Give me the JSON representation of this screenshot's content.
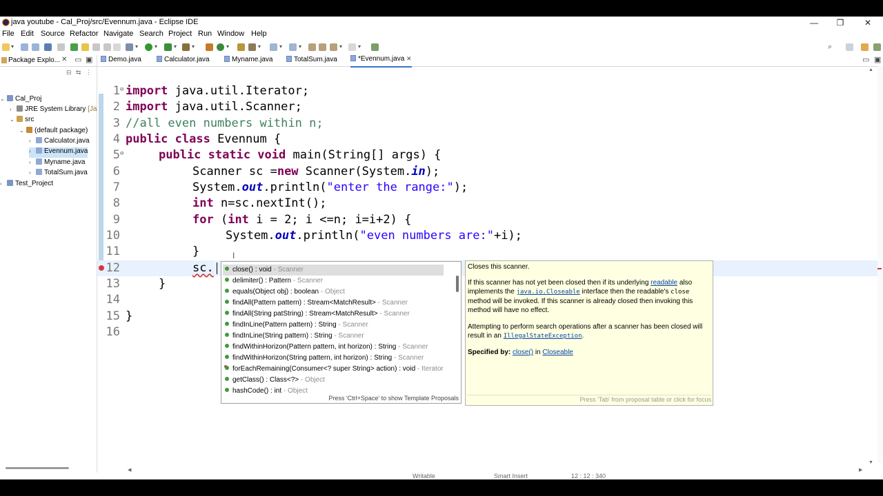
{
  "window": {
    "title": "java youtube - Cal_Proj/src/Evennum.java - Eclipse IDE",
    "minimize": "—",
    "restore": "❐",
    "close": "✕"
  },
  "menu": [
    "File",
    "Edit",
    "Source",
    "Refactor",
    "Navigate",
    "Search",
    "Project",
    "Run",
    "Window",
    "Help"
  ],
  "package_explorer": {
    "tab_label": "Package Explo...",
    "tree": [
      {
        "label": "Cal_Proj",
        "icon": "project-icon"
      },
      {
        "label": "JRE System Library",
        "suffix": "[Ja",
        "icon": "library-icon"
      },
      {
        "label": "src",
        "icon": "source-folder-icon"
      },
      {
        "label": "(default package)",
        "icon": "package-icon"
      },
      {
        "label": "Calculator.java",
        "icon": "java-file-icon"
      },
      {
        "label": "Evennum.java",
        "icon": "java-file-icon"
      },
      {
        "label": "Myname.java",
        "icon": "java-file-icon"
      },
      {
        "label": "TotalSum.java",
        "icon": "java-file-icon"
      },
      {
        "label": "Test_Project",
        "icon": "project-icon"
      }
    ]
  },
  "editor_tabs": [
    "Demo.java",
    "Calculator.java",
    "Myname.java",
    "TotalSum.java",
    "*Evennum.java"
  ],
  "code_lines": [
    {
      "n": "1",
      "marker": "⊖"
    },
    {
      "n": "2"
    },
    {
      "n": "3"
    },
    {
      "n": "4"
    },
    {
      "n": "5",
      "marker": "⊖"
    },
    {
      "n": "6"
    },
    {
      "n": "7"
    },
    {
      "n": "8"
    },
    {
      "n": "9"
    },
    {
      "n": "10"
    },
    {
      "n": "11"
    },
    {
      "n": "12"
    },
    {
      "n": "13"
    },
    {
      "n": "14"
    },
    {
      "n": "15"
    },
    {
      "n": "16"
    }
  ],
  "code": {
    "l1_kw": "import",
    "l1_rest": " java.util.Iterator;",
    "l2_kw": "import",
    "l2_rest": " java.util.Scanner;",
    "l3": "//all even numbers within n;",
    "l4_kw": "public class",
    "l4_rest": " Evennum {",
    "l5_kw": "public static void",
    "l5_rest": " main(String[] args) {",
    "l6_a": "Scanner sc =",
    "l6_kw": "new",
    "l6_b": " Scanner(System.",
    "l6_fl": "in",
    "l6_c": ");",
    "l7_a": "System.",
    "l7_fl": "out",
    "l7_b": ".println(",
    "l7_st": "\"enter the range:\"",
    "l7_c": ");",
    "l8_kw": "int",
    "l8_rest": " n=sc.nextInt();",
    "l9_kw": "for",
    "l9_a": " (",
    "l9_kw2": "int",
    "l9_b": " i = 2; i <=n; i=i+2) {",
    "l10_a": "System.",
    "l10_fl": "out",
    "l10_b": ".println(",
    "l10_st": "\"even numbers are:\"",
    "l10_c": "+i);",
    "l11": "}",
    "l12": "sc.",
    "l13": "}",
    "l15": "}"
  },
  "completion": {
    "proposals": [
      {
        "sig": "close() : void",
        "qual": "Scanner"
      },
      {
        "sig": "delimiter() : Pattern",
        "qual": "Scanner"
      },
      {
        "sig": "equals(Object obj) : boolean",
        "qual": "Object"
      },
      {
        "sig": "findAll(Pattern pattern) : Stream<MatchResult>",
        "qual": "Scanner"
      },
      {
        "sig": "findAll(String patString) : Stream<MatchResult>",
        "qual": "Scanner"
      },
      {
        "sig": "findInLine(Pattern pattern) : String",
        "qual": "Scanner"
      },
      {
        "sig": "findInLine(String pattern) : String",
        "qual": "Scanner"
      },
      {
        "sig": "findWithinHorizon(Pattern pattern, int horizon) : String",
        "qual": "Scanner"
      },
      {
        "sig": "findWithinHorizon(String pattern, int horizon) : String",
        "qual": "Scanner"
      },
      {
        "sig": "forEachRemaining(Consumer<? super String> action) : void",
        "qual": "Iterator"
      },
      {
        "sig": "getClass() : Class<?>",
        "qual": "Object"
      },
      {
        "sig": "hashCode() : int",
        "qual": "Object"
      }
    ],
    "separator": " - ",
    "footer": "Press 'Ctrl+Space' to show Template Proposals"
  },
  "doc": {
    "title": "Closes this scanner.",
    "p1_a": "If this scanner has not yet been closed then if its underlying ",
    "p1_link": "readable",
    "p1_b": " also implements the ",
    "p1_code": "java.io.Closeable",
    "p1_c": " interface then the readable's ",
    "p1_code2": "close",
    "p1_d": " method will be invoked. If this scanner is already closed then invoking this method will have no effect.",
    "p2_a": "Attempting to perform search operations after a scanner has been closed will result in an ",
    "p2_code": "IllegalStateException",
    "p2_b": ".",
    "spec_label": "Specified by:",
    "spec_link1": "close()",
    "spec_in": " in ",
    "spec_link2": "Closeable",
    "footer": "Press 'Tab' from proposal table or click for focus"
  },
  "status": {
    "writable": "Writable",
    "insert": "Smart Insert",
    "position": "12 : 12 : 340"
  },
  "colors": {
    "keyword": "#7f0055",
    "comment": "#3f7f5f",
    "string": "#2a00ff",
    "field": "#0000c0",
    "current_line": "#e8f2fe",
    "doc_bg": "#ffffe1"
  }
}
